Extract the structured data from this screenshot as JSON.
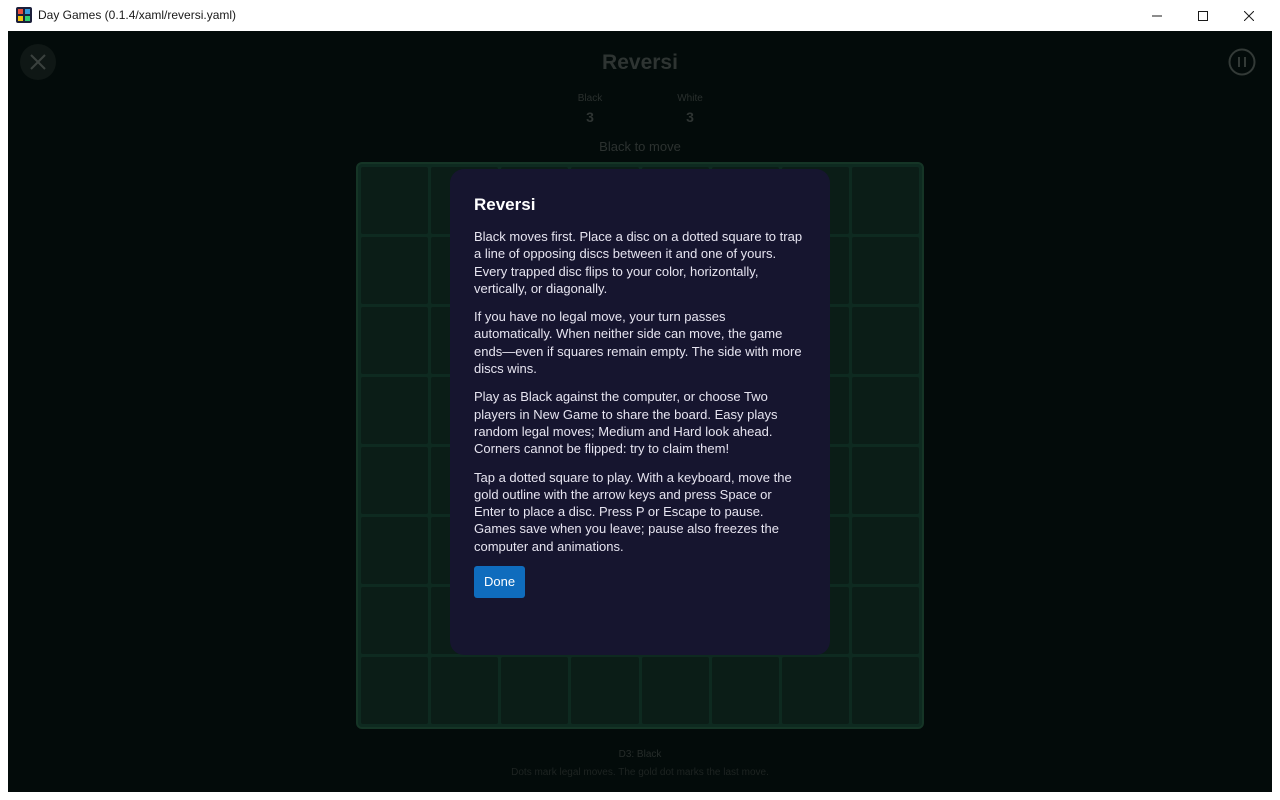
{
  "window": {
    "title": "Day Games (0.1.4/xaml/reversi.yaml)"
  },
  "game": {
    "title": "Reversi",
    "scores": [
      {
        "label": "Black",
        "value": "3"
      },
      {
        "label": "White",
        "value": "3"
      }
    ],
    "status": "Black to move",
    "last_move": "D3: Black",
    "hint": "Dots mark legal moves. The gold dot marks the last move.",
    "board_size": 8
  },
  "dialog": {
    "title": "Reversi",
    "paragraphs": [
      "Black moves first. Place a disc on a dotted square to trap a line of opposing discs between it and one of yours. Every trapped disc flips to your color, horizontally, vertically, or diagonally.",
      "If you have no legal move, your turn passes automatically. When neither side can move, the game ends—even if squares remain empty. The side with more discs wins.",
      "Play as Black against the computer, or choose Two players in New Game to share the board. Easy plays random legal moves; Medium and Hard look ahead. Corners cannot be flipped: try to claim them!",
      "Tap a dotted square to play. With a keyboard, move the gold outline with the arrow keys and press Space or Enter to place a disc. Press P or Escape to pause. Games save when you leave; pause also freezes the computer and animations."
    ],
    "done_label": "Done"
  },
  "icons": {
    "close_game": "close-icon",
    "pause_game": "pause-icon",
    "minimize": "minimize-icon",
    "maximize": "maximize-icon",
    "close_window": "close-window-icon"
  },
  "colors": {
    "accent": "#0f6cbd",
    "dialog_bg": "#16152f",
    "board": "#0e2a20",
    "background": "#030b0a"
  }
}
